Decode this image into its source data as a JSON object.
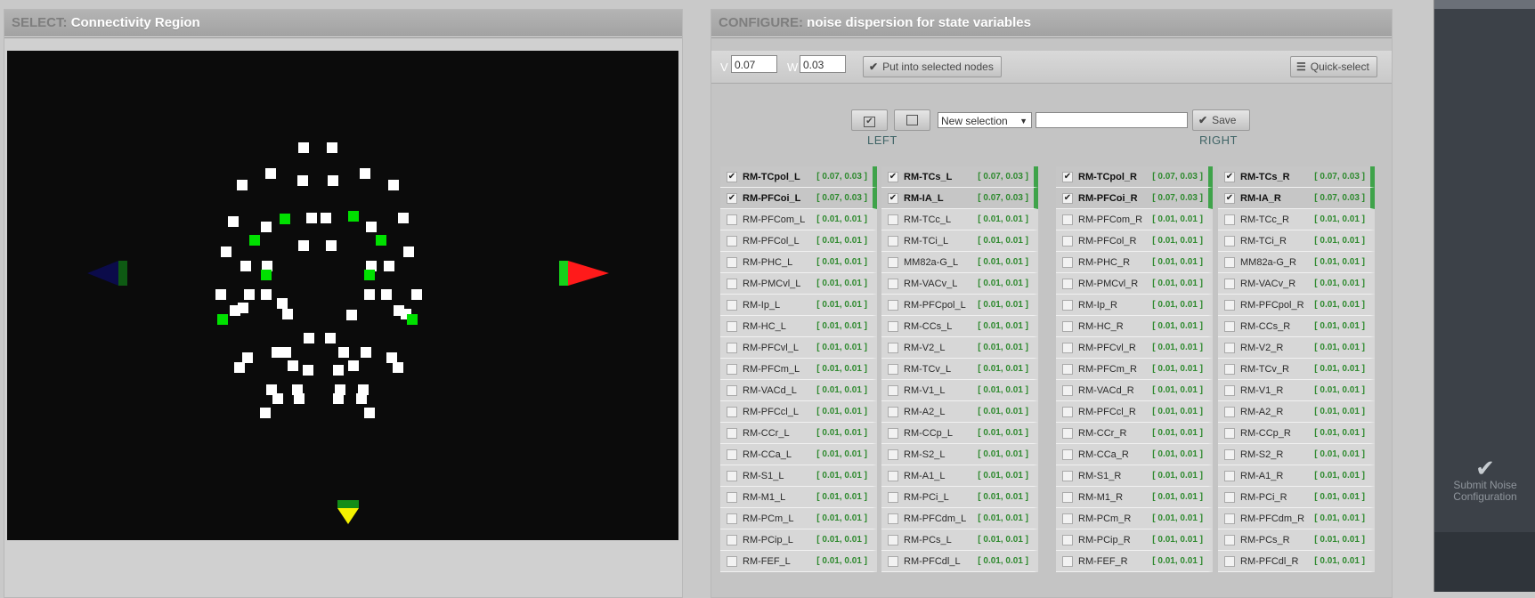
{
  "select_panel": {
    "lead": "SELECT:",
    "title": "Connectivity Region"
  },
  "configure_panel": {
    "lead": "CONFIGURE:",
    "title": "noise dispersion for state variables"
  },
  "toolbar": {
    "v_label": "V",
    "v_value": "0.07",
    "w_label": "W",
    "w_value": "0.03",
    "put_button": "Put into selected nodes",
    "quick_select": "Quick-select"
  },
  "selection": {
    "dropdown": "New selection",
    "save_button": "Save",
    "left_label": "LEFT",
    "right_label": "RIGHT"
  },
  "submit": {
    "line1": "Submit Noise",
    "line2": "Configuration"
  },
  "columns": [
    {
      "rows": [
        {
          "name": "RM-TCpol_L",
          "value": "[ 0.07, 0.03 ]",
          "checked": true
        },
        {
          "name": "RM-PFCoi_L",
          "value": "[ 0.07, 0.03 ]",
          "checked": true
        },
        {
          "name": "RM-PFCom_L",
          "value": "[ 0.01, 0.01 ]",
          "checked": false
        },
        {
          "name": "RM-PFCol_L",
          "value": "[ 0.01, 0.01 ]",
          "checked": false
        },
        {
          "name": "RM-PHC_L",
          "value": "[ 0.01, 0.01 ]",
          "checked": false
        },
        {
          "name": "RM-PMCvl_L",
          "value": "[ 0.01, 0.01 ]",
          "checked": false
        },
        {
          "name": "RM-Ip_L",
          "value": "[ 0.01, 0.01 ]",
          "checked": false
        },
        {
          "name": "RM-HC_L",
          "value": "[ 0.01, 0.01 ]",
          "checked": false
        },
        {
          "name": "RM-PFCvl_L",
          "value": "[ 0.01, 0.01 ]",
          "checked": false
        },
        {
          "name": "RM-PFCm_L",
          "value": "[ 0.01, 0.01 ]",
          "checked": false
        },
        {
          "name": "RM-VACd_L",
          "value": "[ 0.01, 0.01 ]",
          "checked": false
        },
        {
          "name": "RM-PFCcl_L",
          "value": "[ 0.01, 0.01 ]",
          "checked": false
        },
        {
          "name": "RM-CCr_L",
          "value": "[ 0.01, 0.01 ]",
          "checked": false
        },
        {
          "name": "RM-CCa_L",
          "value": "[ 0.01, 0.01 ]",
          "checked": false
        },
        {
          "name": "RM-S1_L",
          "value": "[ 0.01, 0.01 ]",
          "checked": false
        },
        {
          "name": "RM-M1_L",
          "value": "[ 0.01, 0.01 ]",
          "checked": false
        },
        {
          "name": "RM-PCm_L",
          "value": "[ 0.01, 0.01 ]",
          "checked": false
        },
        {
          "name": "RM-PCip_L",
          "value": "[ 0.01, 0.01 ]",
          "checked": false
        },
        {
          "name": "RM-FEF_L",
          "value": "[ 0.01, 0.01 ]",
          "checked": false
        }
      ]
    },
    {
      "rows": [
        {
          "name": "RM-TCs_L",
          "value": "[ 0.07, 0.03 ]",
          "checked": true
        },
        {
          "name": "RM-IA_L",
          "value": "[ 0.07, 0.03 ]",
          "checked": true
        },
        {
          "name": "RM-TCc_L",
          "value": "[ 0.01, 0.01 ]",
          "checked": false
        },
        {
          "name": "RM-TCi_L",
          "value": "[ 0.01, 0.01 ]",
          "checked": false
        },
        {
          "name": "MM82a-G_L",
          "value": "[ 0.01, 0.01 ]",
          "checked": false
        },
        {
          "name": "RM-VACv_L",
          "value": "[ 0.01, 0.01 ]",
          "checked": false
        },
        {
          "name": "RM-PFCpol_L",
          "value": "[ 0.01, 0.01 ]",
          "checked": false
        },
        {
          "name": "RM-CCs_L",
          "value": "[ 0.01, 0.01 ]",
          "checked": false
        },
        {
          "name": "RM-V2_L",
          "value": "[ 0.01, 0.01 ]",
          "checked": false
        },
        {
          "name": "RM-TCv_L",
          "value": "[ 0.01, 0.01 ]",
          "checked": false
        },
        {
          "name": "RM-V1_L",
          "value": "[ 0.01, 0.01 ]",
          "checked": false
        },
        {
          "name": "RM-A2_L",
          "value": "[ 0.01, 0.01 ]",
          "checked": false
        },
        {
          "name": "RM-CCp_L",
          "value": "[ 0.01, 0.01 ]",
          "checked": false
        },
        {
          "name": "RM-S2_L",
          "value": "[ 0.01, 0.01 ]",
          "checked": false
        },
        {
          "name": "RM-A1_L",
          "value": "[ 0.01, 0.01 ]",
          "checked": false
        },
        {
          "name": "RM-PCi_L",
          "value": "[ 0.01, 0.01 ]",
          "checked": false
        },
        {
          "name": "RM-PFCdm_L",
          "value": "[ 0.01, 0.01 ]",
          "checked": false
        },
        {
          "name": "RM-PCs_L",
          "value": "[ 0.01, 0.01 ]",
          "checked": false
        },
        {
          "name": "RM-PFCdl_L",
          "value": "[ 0.01, 0.01 ]",
          "checked": false
        }
      ]
    },
    {
      "rows": [
        {
          "name": "RM-TCpol_R",
          "value": "[ 0.07, 0.03 ]",
          "checked": true
        },
        {
          "name": "RM-PFCoi_R",
          "value": "[ 0.07, 0.03 ]",
          "checked": true
        },
        {
          "name": "RM-PFCom_R",
          "value": "[ 0.01, 0.01 ]",
          "checked": false
        },
        {
          "name": "RM-PFCol_R",
          "value": "[ 0.01, 0.01 ]",
          "checked": false
        },
        {
          "name": "RM-PHC_R",
          "value": "[ 0.01, 0.01 ]",
          "checked": false
        },
        {
          "name": "RM-PMCvl_R",
          "value": "[ 0.01, 0.01 ]",
          "checked": false
        },
        {
          "name": "RM-Ip_R",
          "value": "[ 0.01, 0.01 ]",
          "checked": false
        },
        {
          "name": "RM-HC_R",
          "value": "[ 0.01, 0.01 ]",
          "checked": false
        },
        {
          "name": "RM-PFCvl_R",
          "value": "[ 0.01, 0.01 ]",
          "checked": false
        },
        {
          "name": "RM-PFCm_R",
          "value": "[ 0.01, 0.01 ]",
          "checked": false
        },
        {
          "name": "RM-VACd_R",
          "value": "[ 0.01, 0.01 ]",
          "checked": false
        },
        {
          "name": "RM-PFCcl_R",
          "value": "[ 0.01, 0.01 ]",
          "checked": false
        },
        {
          "name": "RM-CCr_R",
          "value": "[ 0.01, 0.01 ]",
          "checked": false
        },
        {
          "name": "RM-CCa_R",
          "value": "[ 0.01, 0.01 ]",
          "checked": false
        },
        {
          "name": "RM-S1_R",
          "value": "[ 0.01, 0.01 ]",
          "checked": false
        },
        {
          "name": "RM-M1_R",
          "value": "[ 0.01, 0.01 ]",
          "checked": false
        },
        {
          "name": "RM-PCm_R",
          "value": "[ 0.01, 0.01 ]",
          "checked": false
        },
        {
          "name": "RM-PCip_R",
          "value": "[ 0.01, 0.01 ]",
          "checked": false
        },
        {
          "name": "RM-FEF_R",
          "value": "[ 0.01, 0.01 ]",
          "checked": false
        }
      ]
    },
    {
      "rows": [
        {
          "name": "RM-TCs_R",
          "value": "[ 0.07, 0.03 ]",
          "checked": true
        },
        {
          "name": "RM-IA_R",
          "value": "[ 0.07, 0.03 ]",
          "checked": true
        },
        {
          "name": "RM-TCc_R",
          "value": "[ 0.01, 0.01 ]",
          "checked": false
        },
        {
          "name": "RM-TCi_R",
          "value": "[ 0.01, 0.01 ]",
          "checked": false
        },
        {
          "name": "MM82a-G_R",
          "value": "[ 0.01, 0.01 ]",
          "checked": false
        },
        {
          "name": "RM-VACv_R",
          "value": "[ 0.01, 0.01 ]",
          "checked": false
        },
        {
          "name": "RM-PFCpol_R",
          "value": "[ 0.01, 0.01 ]",
          "checked": false
        },
        {
          "name": "RM-CCs_R",
          "value": "[ 0.01, 0.01 ]",
          "checked": false
        },
        {
          "name": "RM-V2_R",
          "value": "[ 0.01, 0.01 ]",
          "checked": false
        },
        {
          "name": "RM-TCv_R",
          "value": "[ 0.01, 0.01 ]",
          "checked": false
        },
        {
          "name": "RM-V1_R",
          "value": "[ 0.01, 0.01 ]",
          "checked": false
        },
        {
          "name": "RM-A2_R",
          "value": "[ 0.01, 0.01 ]",
          "checked": false
        },
        {
          "name": "RM-CCp_R",
          "value": "[ 0.01, 0.01 ]",
          "checked": false
        },
        {
          "name": "RM-S2_R",
          "value": "[ 0.01, 0.01 ]",
          "checked": false
        },
        {
          "name": "RM-A1_R",
          "value": "[ 0.01, 0.01 ]",
          "checked": false
        },
        {
          "name": "RM-PCi_R",
          "value": "[ 0.01, 0.01 ]",
          "checked": false
        },
        {
          "name": "RM-PFCdm_R",
          "value": "[ 0.01, 0.01 ]",
          "checked": false
        },
        {
          "name": "RM-PCs_R",
          "value": "[ 0.01, 0.01 ]",
          "checked": false
        },
        {
          "name": "RM-PFCdl_R",
          "value": "[ 0.01, 0.01 ]",
          "checked": false
        }
      ]
    }
  ],
  "colors": {
    "selected_accent": "#3fa34a",
    "value_green": "#2f8a2f",
    "node_selected": "#00e000",
    "node": "#ffffff"
  }
}
